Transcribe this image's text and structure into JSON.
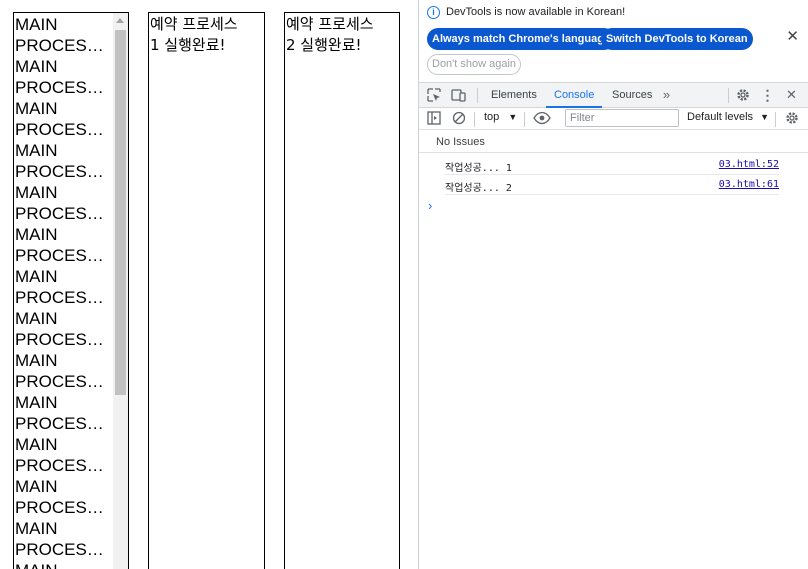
{
  "page": {
    "main_lines": [
      "MAIN",
      "PROCESS...EX",
      "MAIN",
      "PROCESS...EX",
      "MAIN",
      "PROCESS...EX",
      "MAIN",
      "PROCESS...EX",
      "MAIN",
      "PROCESS...EX",
      "MAIN",
      "PROCESS...EX",
      "MAIN",
      "PROCESS...EX",
      "MAIN",
      "PROCESS...EX",
      "MAIN",
      "PROCESS...EX",
      "MAIN",
      "PROCESS...EX",
      "MAIN",
      "PROCESS...EX",
      "MAIN",
      "PROCESS...EX",
      "MAIN",
      "PROCESS...EX",
      "MAIN"
    ],
    "process1": [
      "예약 프로세스",
      "1 실행완료!"
    ],
    "process2": [
      "예약 프로세스",
      "2 실행완료!"
    ]
  },
  "devtools": {
    "notice": {
      "text": "DevTools is now available in Korean!",
      "btn_match": "Always match Chrome's language",
      "btn_switch": "Switch DevTools to Korean",
      "btn_dont_show": "Don't show again"
    },
    "tabs": {
      "elements": "Elements",
      "console": "Console",
      "sources": "Sources"
    },
    "toolbar": {
      "context": "top",
      "filter_placeholder": "Filter",
      "levels": "Default levels"
    },
    "issues": "No Issues",
    "logs": [
      {
        "msg": "작업성공... 1",
        "src": "03.html:52"
      },
      {
        "msg": "작업성공... 2",
        "src": "03.html:61"
      }
    ],
    "prompt": "›"
  },
  "colors": {
    "accent": "#1a73e8",
    "pill_bg": "#0b57d0",
    "scroll_thumb": "#c1c1c1"
  }
}
